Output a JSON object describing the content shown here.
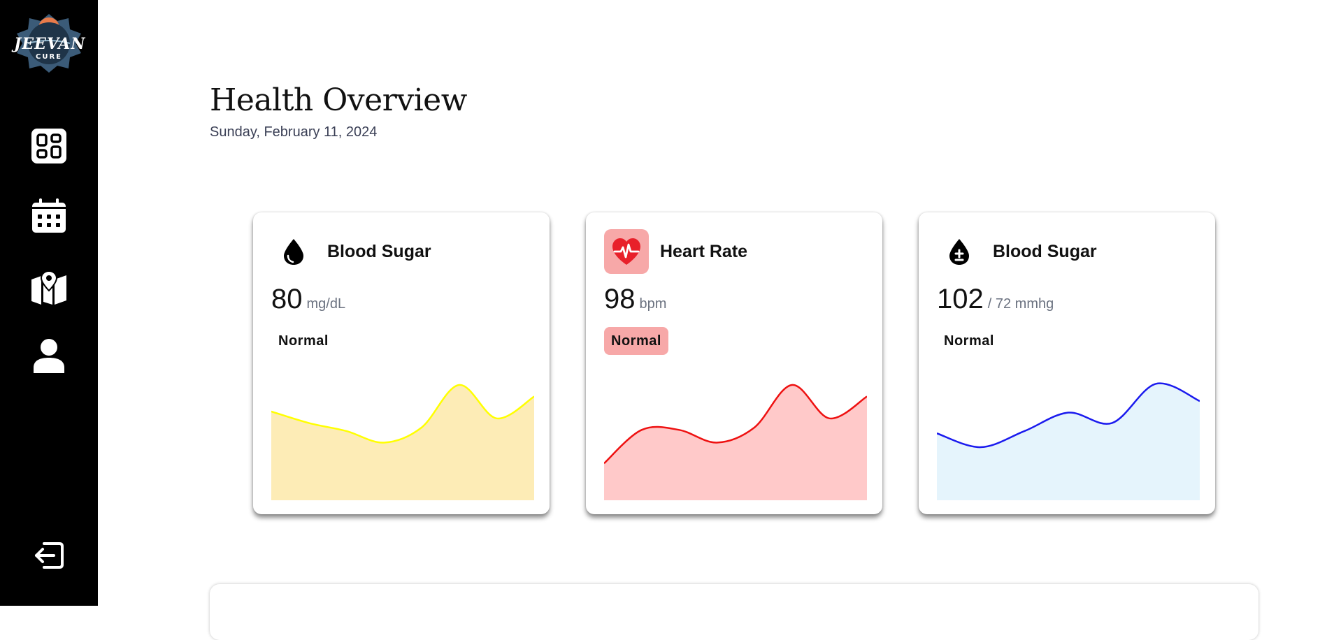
{
  "sidebar": {
    "logo_text": "JEEVAN",
    "logo_subtext": "CURE",
    "nav": [
      "dashboard-icon",
      "calendar-icon",
      "map-icon",
      "user-icon"
    ],
    "logout": "logout-icon"
  },
  "header": {
    "title": "Health Overview",
    "date": "Sunday, February 11, 2024"
  },
  "cards": [
    {
      "icon": "drop-icon",
      "title": "Blood Sugar",
      "value": "80",
      "unit": "mg/dL",
      "status": "Normal",
      "status_bg": "transparent",
      "line_color": "#ffff00",
      "fill_color": "#fdecb6",
      "trend": [
        0.74,
        0.64,
        0.57,
        0.47,
        0.6,
        0.97,
        0.68,
        0.87
      ]
    },
    {
      "icon": "heart-pulse-icon",
      "title": "Heart Rate",
      "value": "98",
      "unit": "bpm",
      "status": "Normal",
      "status_bg": "#f7a8a8",
      "line_color": "#ee1111",
      "fill_color": "#ffc9c9",
      "trend": [
        0.29,
        0.58,
        0.58,
        0.47,
        0.6,
        0.97,
        0.68,
        0.87
      ]
    },
    {
      "icon": "drop-plus-icon",
      "title": "Blood Sugar",
      "value": "102",
      "unit": "/ 72 mmhg",
      "status": "Normal",
      "status_bg": "transparent",
      "line_color": "#1a1aee",
      "fill_color": "#e5f4fc",
      "trend": [
        0.55,
        0.43,
        0.57,
        0.73,
        0.64,
        0.98,
        0.83
      ]
    }
  ]
}
